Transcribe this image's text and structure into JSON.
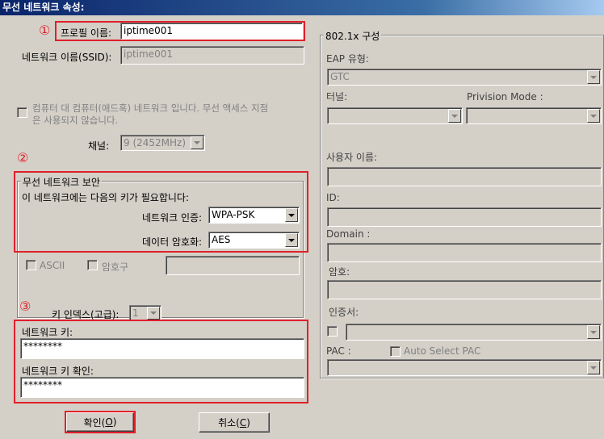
{
  "window": {
    "title": "무선 네트워크 속성:"
  },
  "profile": {
    "label": "프로필 이름:",
    "value": "iptime001"
  },
  "ssid": {
    "label": "네트워크 이름(SSID):",
    "value": "iptime001"
  },
  "adhoc": {
    "label_line1": "컴퓨터 대 컴퓨터(애드혹) 네트워크 입니다. 무선 액세스 지점",
    "label_line2": "은 사용되지 않습니다."
  },
  "channel": {
    "label": "채널:",
    "value": "9  (2452MHz)"
  },
  "security": {
    "legend": "무선 네트워크 보안",
    "note": "이 네트워크에는 다음의 키가 필요합니다:",
    "auth_label": "네트워크 인증:",
    "auth_value": "WPA-PSK",
    "enc_label": "데이터 암호화:",
    "enc_value": "AES",
    "ascii_label": "ASCII",
    "passphrase_label": "암호구",
    "key_index_label": "키 인덱스(고급):",
    "key_index_value": "1",
    "network_key_label": "네트워크 키:",
    "network_key_value": "********",
    "confirm_key_label": "네트워크 키 확인:",
    "confirm_key_value": "********"
  },
  "eap": {
    "legend": "802.1x 구성",
    "type_label": "EAP 유형:",
    "type_value": "GTC",
    "tunnel_label": "터널:",
    "provision_label": "Privision Mode :",
    "username_label": "사용자 이름:",
    "id_label": "ID:",
    "domain_label": "Domain :",
    "password_label": "암호:",
    "cert_label": "인증서:",
    "pac_label": "PAC :",
    "auto_pac_label": "Auto Select PAC"
  },
  "buttons": {
    "ok_label": "확인(",
    "ok_key": "O",
    "ok_end": ")",
    "cancel_label": "취소(",
    "cancel_key": "C",
    "cancel_end": ")"
  },
  "annotations": {
    "one": "①",
    "two": "②",
    "three": "③"
  },
  "colors": {
    "highlight": "#e0202a",
    "title_start": "#0a246a",
    "dialog_bg": "#d4d0c8"
  }
}
